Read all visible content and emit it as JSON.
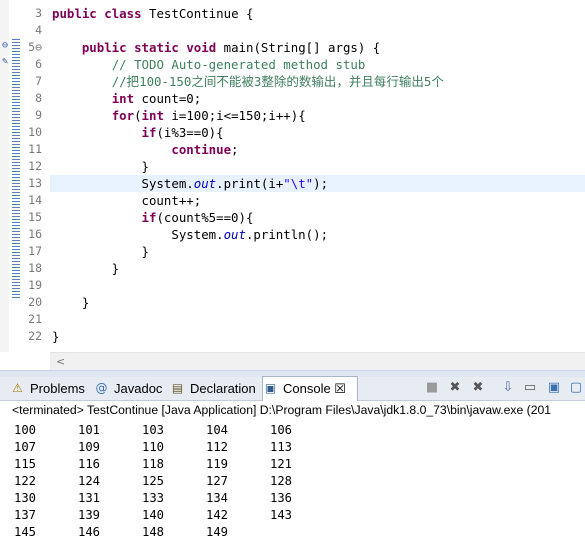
{
  "editor": {
    "lines": [
      {
        "n": "3",
        "html": "<span class=\"kw\">public</span> <span class=\"kw\">class</span> TestContinue {"
      },
      {
        "n": "4",
        "html": ""
      },
      {
        "n": "5⊖",
        "html": "    <span class=\"kw\">public</span> <span class=\"kw\">static</span> <span class=\"kw\">void</span> main(String[] args) {"
      },
      {
        "n": "6",
        "html": "        <span class=\"cm\">// TODO Auto-generated method stub</span>"
      },
      {
        "n": "7",
        "html": "        <span class=\"cm\">//<span class=\"cjk\">把</span>100-150<span class=\"cjk\">之间不能被</span>3<span class=\"cjk\">整除的数输出，并且每行输出</span>5<span class=\"cjk\">个</span></span>"
      },
      {
        "n": "8",
        "html": "        <span class=\"kw\">int</span> count=0;"
      },
      {
        "n": "9",
        "html": "        <span class=\"kw\">for</span>(<span class=\"kw\">int</span> i=100;i&lt;=150;i++){"
      },
      {
        "n": "10",
        "html": "            <span class=\"kw\">if</span>(i%3==0){"
      },
      {
        "n": "11",
        "html": "                <span class=\"kw\">continue</span>;"
      },
      {
        "n": "12",
        "html": "            }"
      },
      {
        "n": "13",
        "html": "            System.<span class=\"fld\">out</span>.print(i+<span class=\"str\">\"\\t\"</span>);",
        "hl": true
      },
      {
        "n": "14",
        "html": "            count++;"
      },
      {
        "n": "15",
        "html": "            <span class=\"kw\">if</span>(count%5==0){"
      },
      {
        "n": "16",
        "html": "                System.<span class=\"fld\">out</span>.println();"
      },
      {
        "n": "17",
        "html": "            }"
      },
      {
        "n": "18",
        "html": "        }"
      },
      {
        "n": "19",
        "html": ""
      },
      {
        "n": "20",
        "html": "    }"
      },
      {
        "n": "21",
        "html": ""
      },
      {
        "n": "22",
        "html": "}"
      }
    ]
  },
  "tabs": [
    {
      "label": "Problems",
      "icon": "problems-icon",
      "glyph": "⚠"
    },
    {
      "label": "Javadoc",
      "icon": "javadoc-icon",
      "glyph": "@"
    },
    {
      "label": "Declaration",
      "icon": "declaration-icon",
      "glyph": "▤"
    },
    {
      "label": "Console ☒",
      "icon": "console-icon",
      "glyph": "▣",
      "active": true
    }
  ],
  "toolbar": [
    "terminate-icon",
    "remove-launch-icon",
    "remove-all-icon",
    "scroll-lock-icon",
    "word-wrap-icon",
    "pin-console-icon",
    "display-console-icon"
  ],
  "console": {
    "status": "<terminated> TestContinue [Java Application] D:\\Program Files\\Java\\jdk1.8.0_73\\bin\\javaw.exe (201",
    "rows": [
      [
        "100",
        "101",
        "103",
        "104",
        "106"
      ],
      [
        "107",
        "109",
        "110",
        "112",
        "113"
      ],
      [
        "115",
        "116",
        "118",
        "119",
        "121"
      ],
      [
        "122",
        "124",
        "125",
        "127",
        "128"
      ],
      [
        "130",
        "131",
        "133",
        "134",
        "136"
      ],
      [
        "137",
        "139",
        "140",
        "142",
        "143"
      ],
      [
        "145",
        "146",
        "148",
        "149",
        ""
      ]
    ]
  }
}
